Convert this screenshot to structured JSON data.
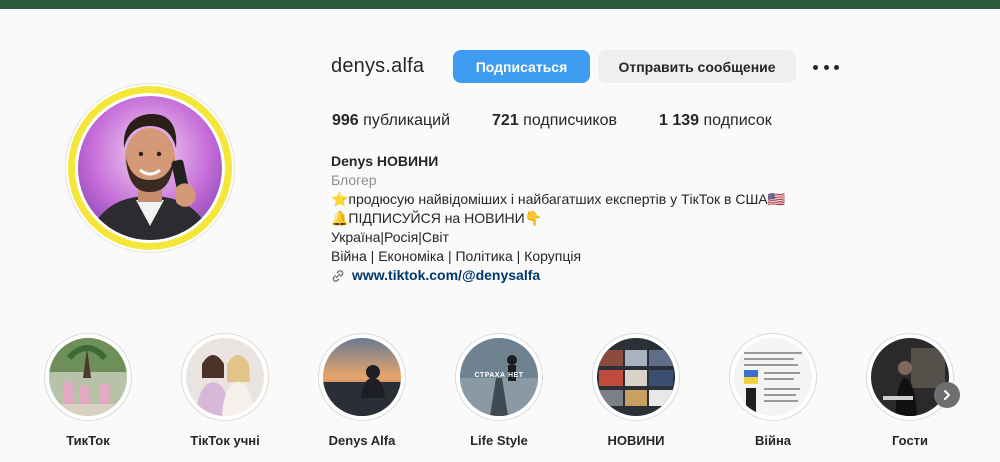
{
  "profile": {
    "username": "denys.alfa",
    "follow_label": "Подписаться",
    "message_label": "Отправить сообщение",
    "more_icon": "more-horizontal-icon"
  },
  "stats": {
    "posts_count": "996",
    "posts_label": "публикаций",
    "followers_count": "721",
    "followers_label": "подписчиков",
    "following_count": "1 139",
    "following_label": "подписок"
  },
  "bio": {
    "name": "Denys НОВИНИ",
    "category": "Блогер",
    "lines": [
      "⭐️продюсую найвідоміших і найбагатших експертів у ТікТок в США🇺🇸",
      "🔔ПІДПИСУЙСЯ на НОВИНИ👇",
      "Україна|Росія|Світ",
      "Війна | Економіка | Політика | Корупція"
    ],
    "link": "www.tiktok.com/@denysalfa"
  },
  "highlights": [
    {
      "label": "ТикТок"
    },
    {
      "label": "ТікТок учні"
    },
    {
      "label": "Denys Alfa"
    },
    {
      "label": "Life Style",
      "overlay": "СТРАХА НЕТ"
    },
    {
      "label": "НОВИНИ"
    },
    {
      "label": "Війна"
    },
    {
      "label": "Гости"
    }
  ],
  "colors": {
    "topbar": "#2e5a3d",
    "follow_button": "#3d9bf0",
    "story_ring": "#f5e63a",
    "link": "#00376b"
  }
}
